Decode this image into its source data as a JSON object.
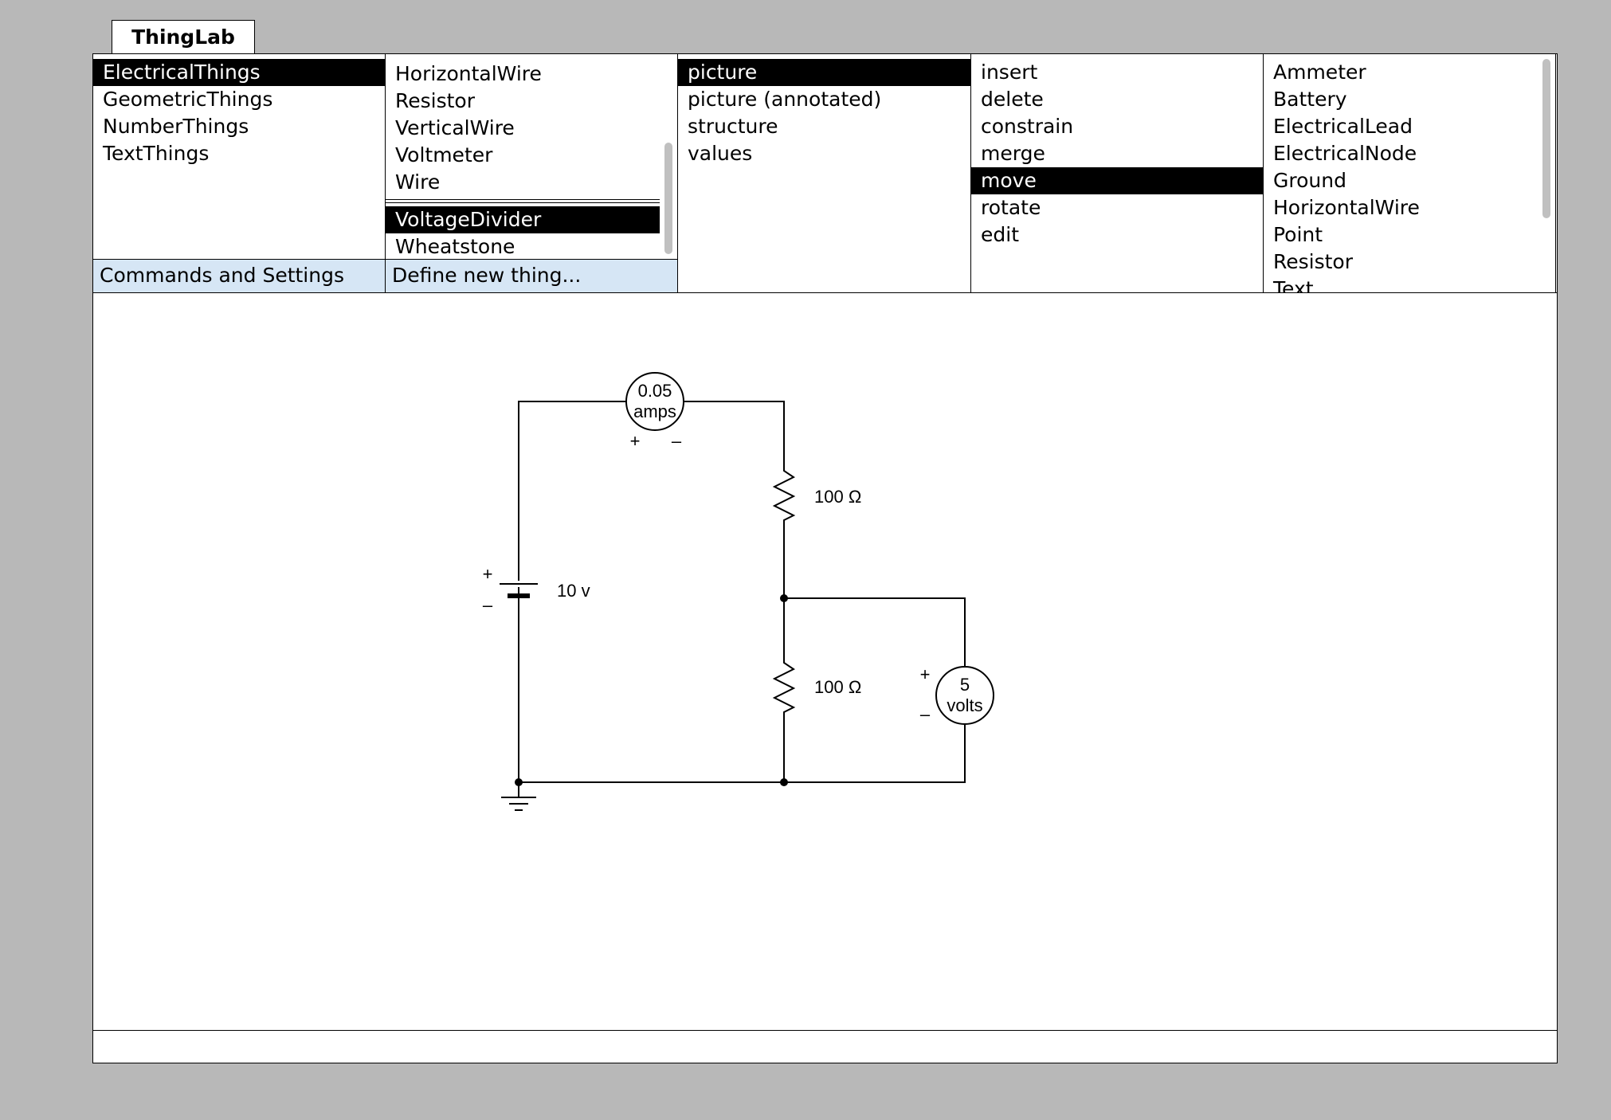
{
  "tab": {
    "title": "ThingLab"
  },
  "categories": {
    "items": [
      "ElectricalThings",
      "GeometricThings",
      "NumberThings",
      "TextThings"
    ],
    "selected": 0,
    "footer": "Commands and Settings"
  },
  "things": {
    "items_top": [
      "HorizontalWire",
      "Resistor",
      "VerticalWire",
      "Voltmeter",
      "Wire"
    ],
    "items_bottom": [
      "VoltageDivider",
      "Wheatstone"
    ],
    "selected": "VoltageDivider",
    "footer": "Define new thing..."
  },
  "views": {
    "items": [
      "picture",
      "picture (annotated)",
      "structure",
      "values"
    ],
    "selected": 0
  },
  "commands": {
    "items": [
      "insert",
      "delete",
      "constrain",
      "merge",
      "move",
      "rotate",
      "edit"
    ],
    "selected": 4
  },
  "parts": {
    "items": [
      "Ammeter",
      "Battery",
      "ElectricalLead",
      "ElectricalNode",
      "Ground",
      "HorizontalWire",
      "Point",
      "Resistor",
      "Text"
    ]
  },
  "circuit": {
    "ammeter_value": "0.05",
    "ammeter_unit": "amps",
    "ammeter_plus": "+",
    "ammeter_minus": "–",
    "resistor_top_label": "100 Ω",
    "resistor_bottom_label": "100 Ω",
    "battery_label": "10 v",
    "battery_plus": "+",
    "battery_minus": "–",
    "voltmeter_value": "5",
    "voltmeter_unit": "volts",
    "voltmeter_plus": "+",
    "voltmeter_minus": "–"
  },
  "colors": {
    "background": "#b8b8b8",
    "selection": "#000000",
    "footer_bar": "#d6e6f5"
  }
}
